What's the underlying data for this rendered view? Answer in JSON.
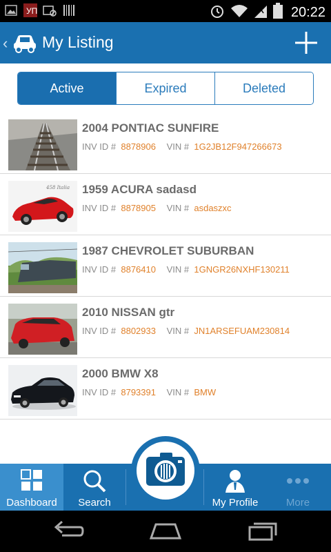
{
  "status_bar": {
    "time": "20:22"
  },
  "app_bar": {
    "title": "My Listing"
  },
  "tabs": [
    {
      "label": "Active",
      "selected": true
    },
    {
      "label": "Expired",
      "selected": false
    },
    {
      "label": "Deleted",
      "selected": false
    }
  ],
  "listings": [
    {
      "title": "2004 PONTIAC SUNFIRE",
      "inv_label": "INV ID #",
      "inv": "8878906",
      "vin_label": "VIN #",
      "vin": "1G2JB12F947266673"
    },
    {
      "title": "1959 ACURA sadasd",
      "inv_label": "INV ID #",
      "inv": "8878905",
      "vin_label": "VIN #",
      "vin": "asdaszxc"
    },
    {
      "title": "1987 CHEVROLET SUBURBAN",
      "inv_label": "INV ID #",
      "inv": "8876410",
      "vin_label": "VIN #",
      "vin": "1GNGR26NXHF130211"
    },
    {
      "title": "2010 NISSAN gtr",
      "inv_label": "INV ID #",
      "inv": "8802933",
      "vin_label": "VIN #",
      "vin": "JN1ARSEFUAM230814"
    },
    {
      "title": "2000 BMW X8",
      "inv_label": "INV ID #",
      "inv": "8793391",
      "vin_label": "VIN #",
      "vin": "BMW"
    }
  ],
  "bottom_nav": {
    "dashboard": "Dashboard",
    "search": "Search",
    "profile": "My Profile",
    "more": "More"
  },
  "colors": {
    "primary": "#1a70b0",
    "accent": "#e0812b",
    "title_text": "#6b6b6b"
  }
}
